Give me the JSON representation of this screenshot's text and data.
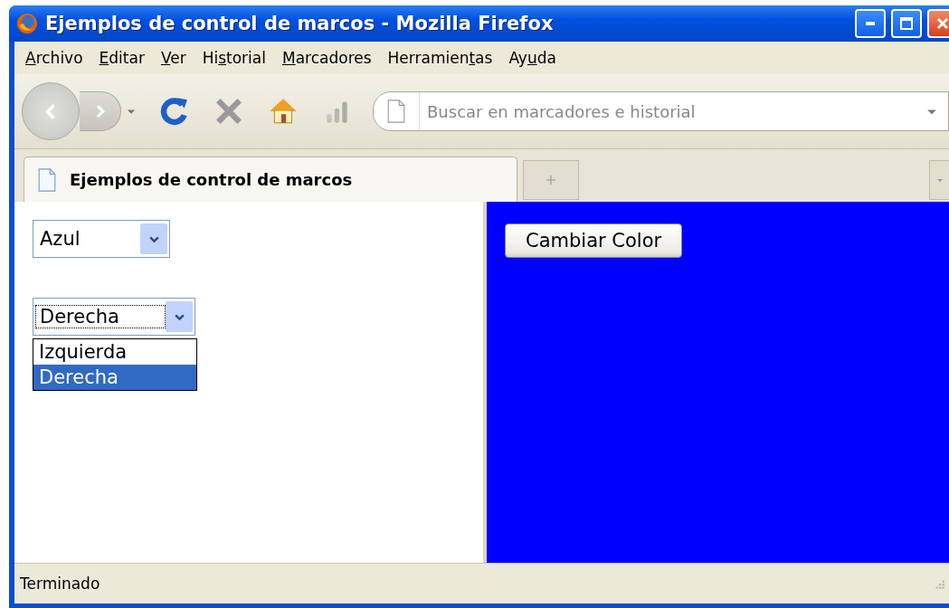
{
  "window": {
    "title": "Ejemplos de control de marcos - Mozilla Firefox"
  },
  "menu": [
    {
      "key": "A",
      "rest": "rchivo"
    },
    {
      "key": "E",
      "rest": "ditar"
    },
    {
      "key": "V",
      "rest": "er"
    },
    {
      "before": "Hi",
      "key": "s",
      "rest": "torial"
    },
    {
      "key": "M",
      "rest": "arcadores"
    },
    {
      "before": "Herramien",
      "key": "t",
      "rest": "as"
    },
    {
      "before": "Ay",
      "key": "u",
      "rest": "da"
    }
  ],
  "search": {
    "placeholder": "Buscar en marcadores e historial"
  },
  "tabs": [
    {
      "label": "Ejemplos de control de marcos",
      "selected": true
    }
  ],
  "left_frame": {
    "color_select": {
      "value": "Azul"
    },
    "side_select": {
      "value": "Derecha",
      "focused": true,
      "expanded": true,
      "options": [
        {
          "label": "Izquierda",
          "selected": false
        },
        {
          "label": "Derecha",
          "selected": true
        }
      ]
    }
  },
  "right_frame": {
    "button": "Cambiar Color"
  },
  "status_bar": {
    "text": "Terminado"
  }
}
